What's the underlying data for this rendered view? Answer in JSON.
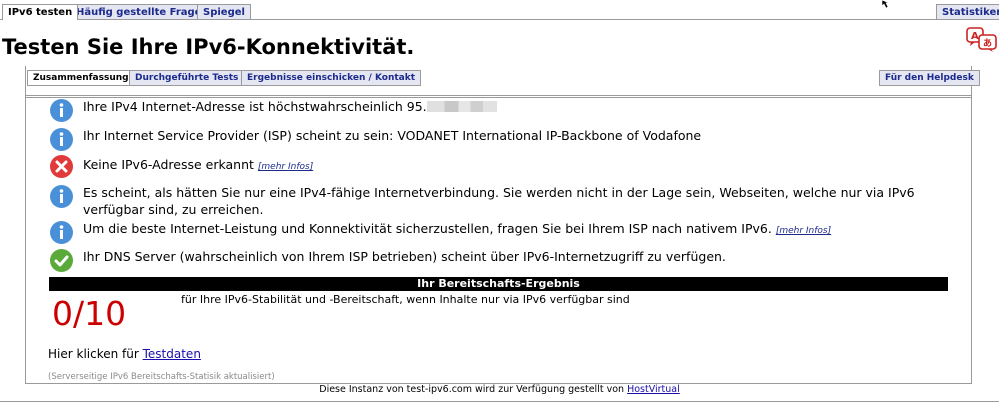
{
  "top_tabs": {
    "items": [
      "IPv6 testen",
      "Häufig gestellte Fragen",
      "Spiegel"
    ],
    "stats": "Statistiken"
  },
  "page_title": "Testen Sie Ihre IPv6-Konnektivität.",
  "sub_tabs": {
    "items": [
      "Zusammenfassung",
      "Durchgeführte Tests",
      "Ergebnisse einschicken / Kontakt"
    ],
    "helpdesk": "Für den Helpdesk"
  },
  "results": [
    {
      "icon": "info-icon",
      "text": "Ihre IPv4 Internet-Adresse ist höchstwahrscheinlich 95."
    },
    {
      "icon": "info-icon",
      "text": "Ihr Internet Service Provider (ISP) scheint zu sein: VODANET International IP-Backbone of Vodafone"
    },
    {
      "icon": "error-icon",
      "text": "Keine IPv6-Adresse erkannt",
      "more": "[mehr Infos]"
    },
    {
      "icon": "info-icon",
      "text": "Es scheint, als hätten Sie nur eine IPv4-fähige Internetverbindung. Sie werden nicht in der Lage sein, Webseiten, welche nur via IPv6 verfügbar sind, zu erreichen."
    },
    {
      "icon": "info-icon",
      "text": "Um die beste Internet-Leistung und Konnektivität sicherzustellen, fragen Sie bei Ihrem ISP nach nativem IPv6.",
      "more": "[mehr Infos]"
    },
    {
      "icon": "check-icon",
      "text": "Ihr DNS Server (wahrscheinlich von Ihrem ISP betrieben) scheint über IPv6-Internetzugriff zu verfügen."
    }
  ],
  "readiness": {
    "header": "Ihr Bereitschafts-Ergebnis",
    "score": "0/10",
    "description": "für Ihre IPv6-Stabilität und -Bereitschaft, wenn Inhalte nur via IPv6 verfügbar sind"
  },
  "testdata": {
    "prefix": "Hier klicken für",
    "link": "Testdaten"
  },
  "stat_note": "(Serverseitige IPv6 Bereitschafts-Statisik aktualisiert)",
  "footer": {
    "text": "Diese Instanz von test-ipv6.com wird zur Verfügung gestellt von",
    "link": "HostVirtual"
  },
  "colors": {
    "info": "#4a90d9",
    "error": "#e03a3a",
    "check": "#5aaa3a",
    "score": "#cc0000",
    "tab_bg": "#e4e6f2",
    "tab_text": "#1c2a8c"
  }
}
